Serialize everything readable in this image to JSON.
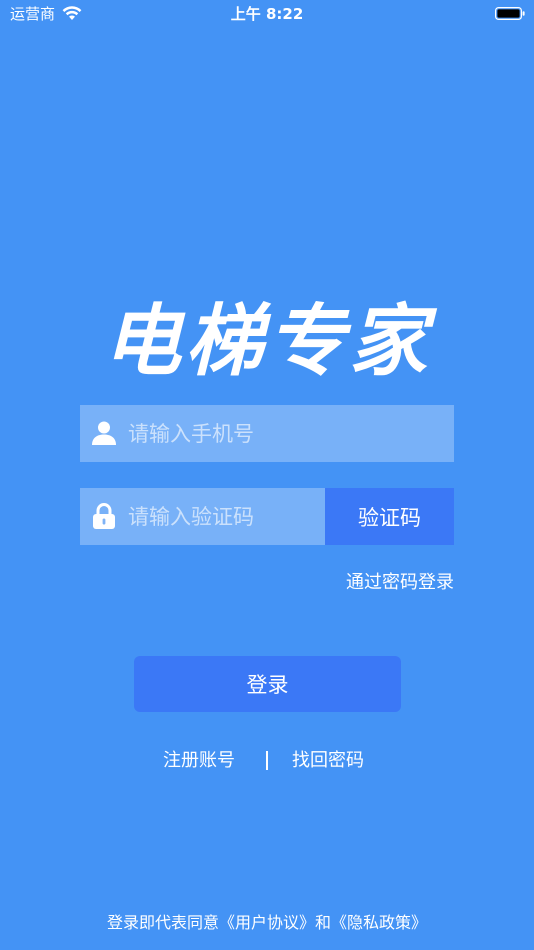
{
  "status_bar": {
    "carrier": "运营商",
    "time": "上午 8:22"
  },
  "app": {
    "title": "电梯专家"
  },
  "login_form": {
    "phone_placeholder": "请输入手机号",
    "code_placeholder": "请输入验证码",
    "code_button_label": "验证码",
    "password_login_label": "通过密码登录",
    "submit_label": "登录"
  },
  "links": {
    "register": "注册账号",
    "recover_password": "找回密码"
  },
  "agreement": {
    "prefix": "登录即代表同意",
    "user_agreement": "《用户协议》",
    "and": "和",
    "privacy_policy": "《隐私政策》"
  },
  "colors": {
    "background": "#4493f5",
    "button": "#3b78f6",
    "text": "#ffffff"
  },
  "icons": {
    "phone_field": "user-icon",
    "code_field": "lock-icon"
  }
}
